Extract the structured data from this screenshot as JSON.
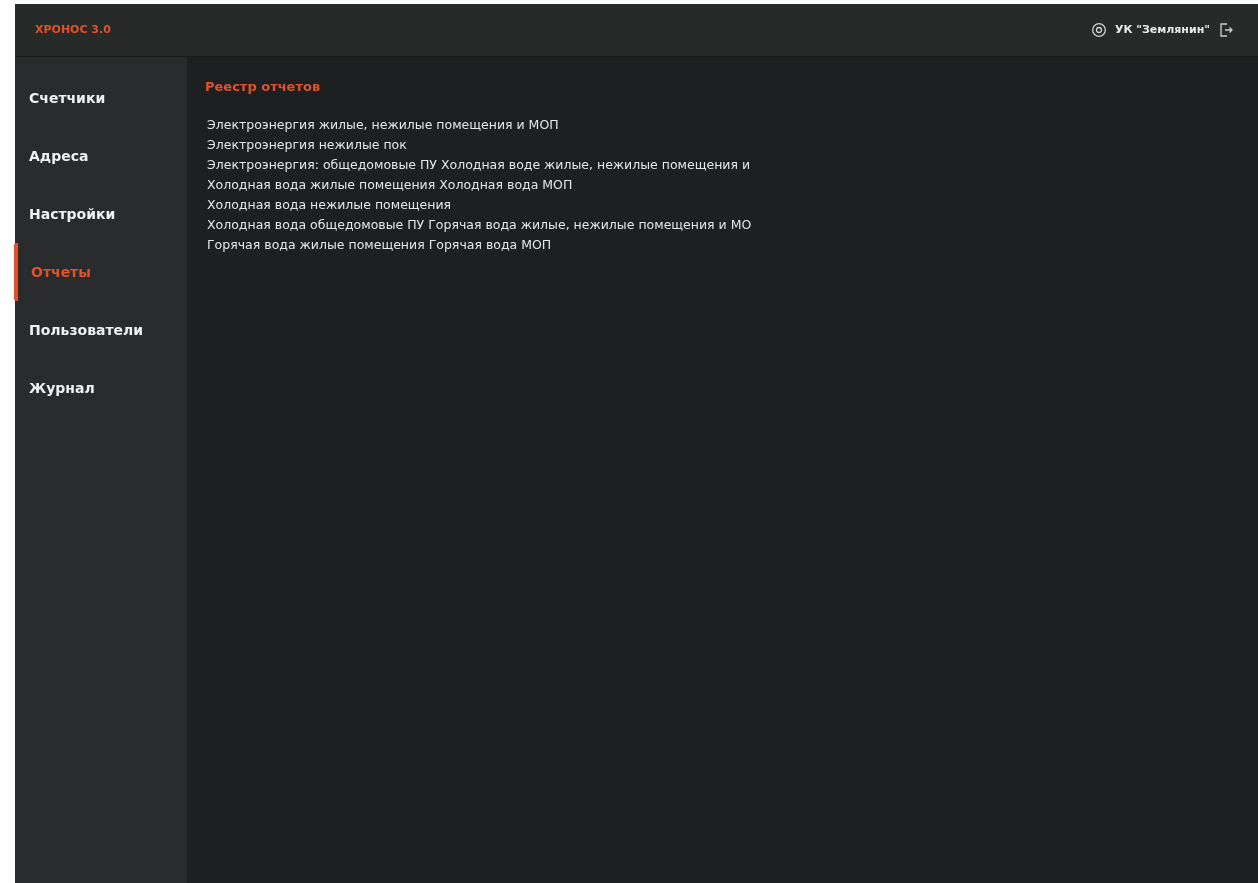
{
  "header": {
    "logo": "ХРОНОС 3.0",
    "organization": "УК \"Землянин\""
  },
  "sidebar": {
    "items": [
      {
        "label": "Счетчики",
        "selected": false
      },
      {
        "label": "Адреса",
        "selected": false
      },
      {
        "label": "Настройки",
        "selected": false
      },
      {
        "label": "Отчеты",
        "selected": true
      },
      {
        "label": "Пользователи",
        "selected": false
      },
      {
        "label": "Журнал",
        "selected": false
      }
    ]
  },
  "content": {
    "title": "Реестр отчетов",
    "reports": [
      "Электроэнергия жилые, нежилые помещения и МОП",
      "Электроэнергия нежилые пок",
      "Электроэнергия: общедомовые ПУ Холодная воде жилые, нежилые помещения и",
      "Холодная вода жилые помещения Холодная вода МОП",
      "Холодная вода нежилые помещения",
      "Холодная вода общедомовые ПУ Горячая вода жилые, нежилые помещения и МО",
      "Горячая вода жилые помещения Горячая вода МОП"
    ]
  }
}
